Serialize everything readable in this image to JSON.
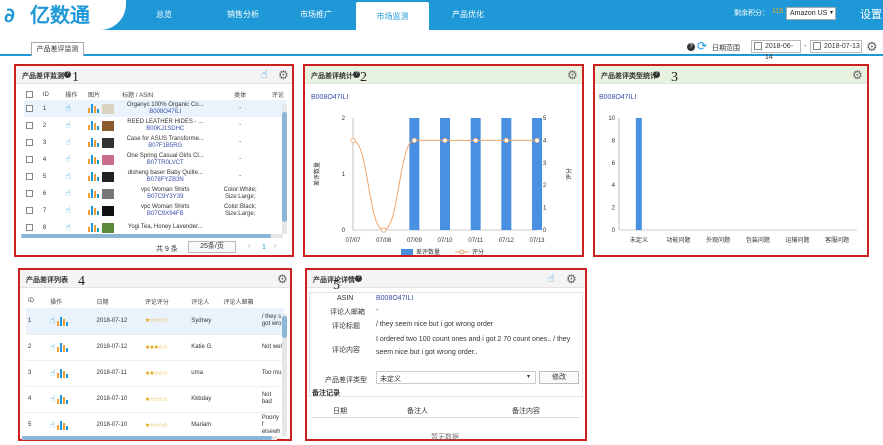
{
  "app": {
    "logo_text": "亿数通",
    "logo_mark": "∂",
    "nav_tabs": [
      "总览",
      "销售分析",
      "市场推广",
      "市场监测",
      "产品优化"
    ],
    "active_tab": "市场监测",
    "balance_label": "剩余积分：",
    "balance_value": "115",
    "marketplace": "Amazon US",
    "settings": "设置"
  },
  "subtab": "产品差评监测",
  "toolbar": {
    "date_range_label": "日期范围",
    "start_date": "2018-06-14",
    "end_date": "2018-07-13",
    "dash": "-"
  },
  "colors": {
    "accent": "#1e98d7",
    "red_box": "#cc1f1f",
    "bar": "#4a90e2",
    "line": "#f0a46a"
  },
  "annotations": [
    "1",
    "2",
    "3",
    "4",
    "5"
  ],
  "panel1": {
    "title": "产品差评监测",
    "columns": [
      "ID",
      "操作",
      "图片",
      "标题 / ASIN",
      "类体",
      "评论"
    ],
    "rows": [
      {
        "id": "1",
        "title": "Organyc 100% Organic Co...",
        "asin": "B008O47ILI",
        "variant": "-"
      },
      {
        "id": "2",
        "title": "REED LEATHER HIDES - ...",
        "asin": "B00KJ1SDHC",
        "variant": "-"
      },
      {
        "id": "3",
        "title": "Case for ASUS Transforme...",
        "asin": "B07F1B5RG",
        "variant": "-"
      },
      {
        "id": "4",
        "title": "One Spring Casual Girls Cl...",
        "asin": "B07TR0LVCT",
        "variant": "-"
      },
      {
        "id": "5",
        "title": "disheng baser Baby Quilte...",
        "asin": "B078FYZB3N",
        "variant": "-"
      },
      {
        "id": "6",
        "title": "vpc Woman Shirts",
        "asin": "B07C9Y3Y39",
        "variant": "Color:White; Size:Large;"
      },
      {
        "id": "7",
        "title": "vpc Woman Shirts",
        "asin": "B07C9X94FB",
        "variant": "Color:Black; Size:Large;"
      },
      {
        "id": "8",
        "title": "Yogi Tea, Honey Lavender...",
        "asin": "",
        "variant": ""
      }
    ],
    "footer": {
      "total": "共 9 条",
      "per_page": "25条/页",
      "page": "1",
      "prev": "‹",
      "next": "›"
    }
  },
  "panel2": {
    "title": "产品差评统计",
    "asin": "B008O47ILI",
    "ylabel_left": "差评数量",
    "ylabel_right": "评分",
    "legend": [
      "差评数量",
      "评分"
    ]
  },
  "panel3": {
    "title": "产品差评类型统计",
    "asin": "B008O47ILI"
  },
  "panel4": {
    "title": "产品差评列表",
    "columns": [
      "ID",
      "操作",
      "日期",
      "评论评分",
      "评论人",
      "评论人邮箱",
      ""
    ],
    "rows": [
      {
        "id": "1",
        "date": "2018-07-12",
        "rating": 1,
        "reviewer": "Sydney",
        "email": "",
        "content": "/ they s got wro"
      },
      {
        "id": "2",
        "date": "2018-07-12",
        "rating": 3,
        "reviewer": "Katie G.",
        "email": "",
        "content": "Not wel"
      },
      {
        "id": "3",
        "date": "2018-07-11",
        "rating": 2,
        "reviewer": "uma",
        "email": "",
        "content": "Too mu"
      },
      {
        "id": "4",
        "date": "2018-07-10",
        "rating": 1,
        "reviewer": "Kkbday",
        "email": "",
        "content": "Not bad"
      },
      {
        "id": "5",
        "date": "2018-07-10",
        "rating": 1,
        "reviewer": "Mariam",
        "email": "",
        "content": "Poorly f elsewh"
      }
    ]
  },
  "panel5": {
    "title": "产品评论详情",
    "asin_label": "ASIN",
    "asin": "B008O47ILI",
    "email_label": "评论人邮箱",
    "email": "-",
    "review_title_label": "评论标题",
    "review_title": "/ they seem nice but i got wrong order",
    "content_label": "评论内容",
    "content": "I ordered two 100 count ones and i got 2 70 count ones.. / they seem nice but i got wrong order..",
    "type_label": "产品差评类型",
    "type_value": "未定义",
    "modify": "修改",
    "notes_title": "备注记录",
    "notes_cols": [
      "日期",
      "备注人",
      "备注内容"
    ],
    "empty": "暂无数据"
  },
  "chart_data": [
    {
      "type": "bar+line",
      "categories": [
        "07/07",
        "07/08",
        "07/09",
        "07/10",
        "07/11",
        "07/12",
        "07/13"
      ],
      "series": [
        {
          "name": "差评数量",
          "values": [
            0,
            0,
            2,
            2,
            2,
            2,
            2
          ]
        },
        {
          "name": "评分",
          "values": [
            4,
            0,
            4,
            4,
            4,
            4,
            4
          ]
        }
      ],
      "ylim_left": [
        0,
        2
      ],
      "yticks_left": [
        "0",
        "1",
        "2"
      ],
      "ylim_right": [
        0,
        5
      ],
      "yticks_right": [
        "0",
        "1",
        "2",
        "3",
        "4",
        "5"
      ],
      "ylabel_left": "差评数量",
      "ylabel_right": "评分",
      "legend_position": "bottom"
    },
    {
      "type": "bar",
      "categories": [
        "未定义",
        "功能问题",
        "外观问题",
        "包装问题",
        "运输问题",
        "客服问题"
      ],
      "values": [
        10,
        0,
        0,
        0,
        0,
        0
      ],
      "ylim": [
        0,
        10
      ],
      "yticks": [
        "0",
        "2",
        "4",
        "6",
        "8",
        "10"
      ]
    }
  ]
}
